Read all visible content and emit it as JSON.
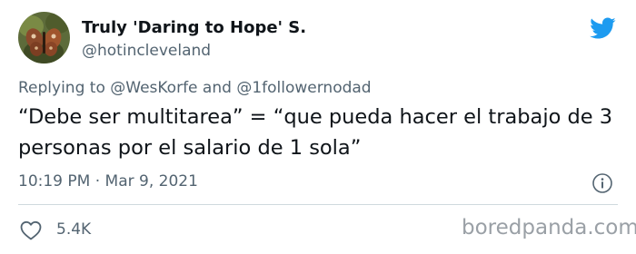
{
  "author": {
    "display_name": "Truly 'Daring to Hope' S.",
    "handle": "@hotincleveland"
  },
  "icons": {
    "platform": "twitter-bird-icon",
    "info": "info-icon",
    "like": "heart-icon"
  },
  "colors": {
    "brand_blue": "#1d9bf0",
    "text_primary": "#0f1419",
    "text_secondary": "#536471",
    "divider": "#cfd9de"
  },
  "reply": {
    "prefix": "Replying to",
    "mention_1": "@WesKorfe",
    "conjunction": "and",
    "mention_2": "@1followernodad"
  },
  "tweet": {
    "text": "“Debe ser multitarea” = “que pueda hacer el trabajo de 3 personas por el salario de 1 sola”"
  },
  "meta": {
    "time": "10:19 PM",
    "separator": "·",
    "date": "Mar 9, 2021"
  },
  "stats": {
    "likes": "5.4K"
  },
  "watermark": {
    "text": "boredpanda.com"
  }
}
